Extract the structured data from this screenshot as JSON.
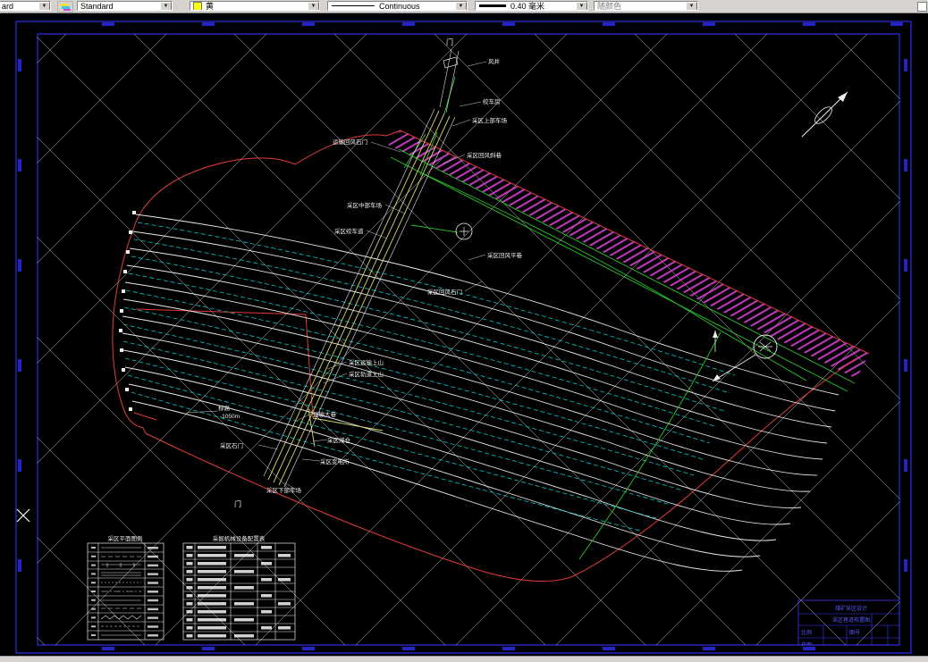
{
  "toolbar": {
    "layer_combo": "ard",
    "style_combo": "Standard",
    "color_combo": "黄",
    "color_swatch_hex": "#ffff00",
    "linetype_combo": "Continuous",
    "lineweight_combo": "0.40 毫米",
    "plotstyle_combo": "随颜色"
  },
  "drawing": {
    "labels": {
      "wind_shaft": "风井",
      "winch_house": "绞车房",
      "upper_yard": "采区上部车场",
      "return_air_crosscut": "运输回风石门",
      "return_air_incline": "采区回风斜巷",
      "middle_yard": "采区中部车场",
      "haulage_incline": "采区绞车道",
      "return_air_level": "采区回风平巷",
      "district_crosscut_upper": "采区回风石门",
      "transport_rise": "采区运输上山",
      "track_rise": "采区轨道上山",
      "elevation_line1": "标高",
      "elevation_line2": "-1050m",
      "main_haulage": "运输大巷",
      "district_crosscut": "采区石门",
      "coal_bunker": "采区煤仓",
      "substation": "采区变电所",
      "lower_yard": "采区下部车场",
      "portal_top": "门",
      "portal_bottom": "门"
    },
    "legend_table_title": "采区平面图例",
    "equipment_table_title": "采掘机械设备配置表",
    "titleblock": {
      "line1": "煤矿采区设计",
      "line2": "采区巷道布置图",
      "cell_scale": "比例",
      "cell_no": "图号",
      "cell_date": "日期"
    }
  }
}
